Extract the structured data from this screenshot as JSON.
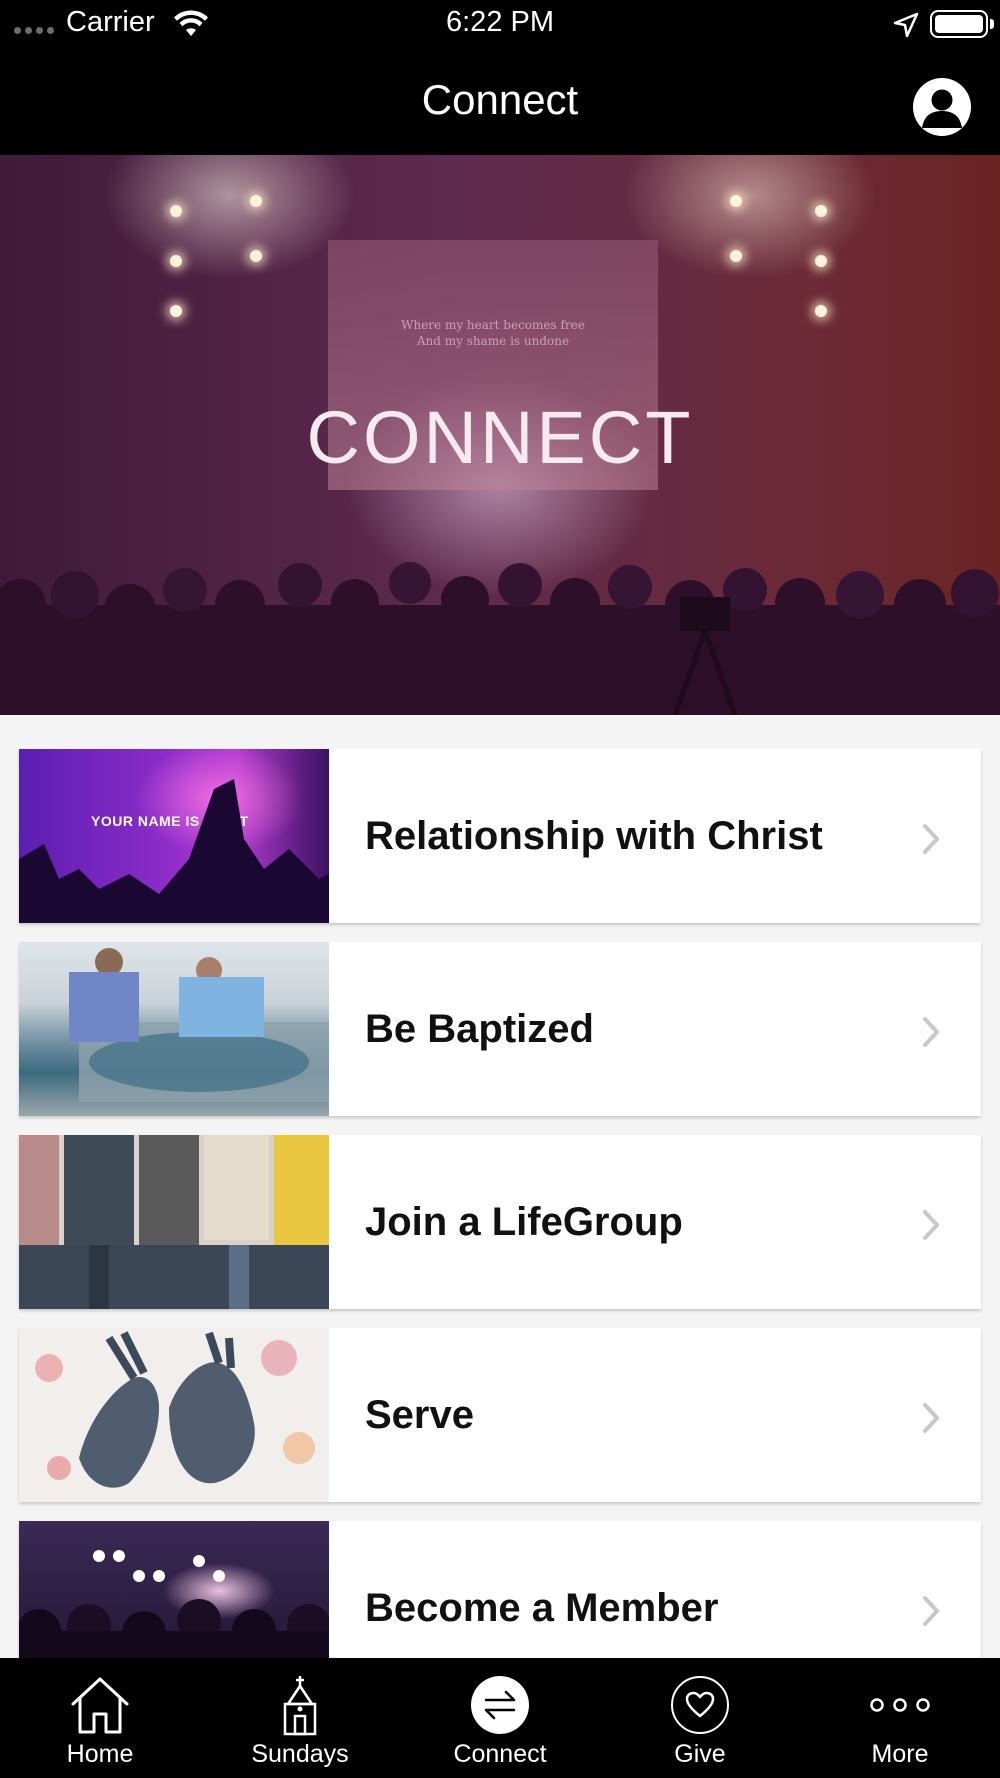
{
  "status_bar": {
    "carrier": "Carrier",
    "time": "6:22 PM"
  },
  "header": {
    "title": "Connect"
  },
  "hero": {
    "title": "CONNECT",
    "lyric_line_1": "Where my heart becomes free",
    "lyric_line_2": "And my shame is undone"
  },
  "list": {
    "items": [
      {
        "label": "Relationship with Christ",
        "thumb_text": "YOUR NAME IS LIGHT"
      },
      {
        "label": "Be Baptized"
      },
      {
        "label": "Join a LifeGroup"
      },
      {
        "label": "Serve"
      },
      {
        "label": "Become a Member"
      }
    ]
  },
  "tabs": [
    {
      "label": "Home",
      "icon": "home-icon",
      "active": false
    },
    {
      "label": "Sundays",
      "icon": "church-icon",
      "active": false
    },
    {
      "label": "Connect",
      "icon": "connect-arrows-icon",
      "active": true
    },
    {
      "label": "Give",
      "icon": "heart-icon",
      "active": false
    },
    {
      "label": "More",
      "icon": "more-dots-icon",
      "active": false
    }
  ],
  "colors": {
    "header_bg": "#000000",
    "list_bg": "#f4f4f4",
    "tab_bar_bg": "#000000",
    "label_text": "#111111",
    "chevron": "#c7c7cc"
  }
}
